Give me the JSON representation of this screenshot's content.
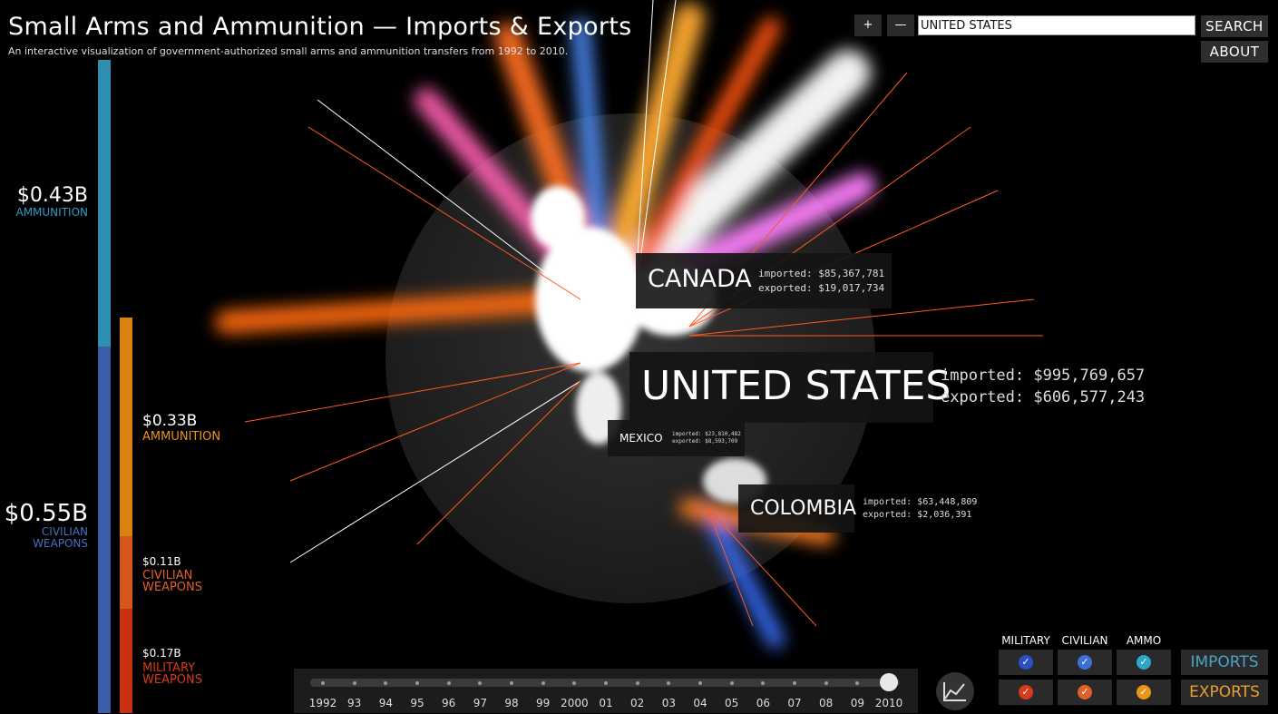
{
  "header": {
    "title": "Small Arms and Ammunition — Imports & Exports",
    "subtitle": "An interactive visualization of government-authorized small arms and ammunition transfers from 1992 to 2010."
  },
  "controls": {
    "zoom_in": "+",
    "zoom_out": "—",
    "search_value": "UNITED STATES",
    "search_label": "SEARCH",
    "about_label": "ABOUT"
  },
  "imports_panel": {
    "total": "$0.55B",
    "total_label_1": "CIVILIAN",
    "total_label_2": "WEAPONS",
    "ammo_value": "$0.43B",
    "ammo_label": "AMMUNITION"
  },
  "exports_panel": {
    "ammo_value": "$0.33B",
    "ammo_label": "AMMUNITION",
    "civilian_value": "$0.11B",
    "civilian_label_1": "CIVILIAN",
    "civilian_label_2": "WEAPONS",
    "military_value": "$0.17B",
    "military_label_1": "MILITARY",
    "military_label_2": "WEAPONS"
  },
  "countries": {
    "selected": {
      "name": "UNITED STATES",
      "imported": "imported: $995,769,657",
      "exported": "exported: $606,577,243"
    },
    "canada": {
      "name": "CANADA",
      "imported": "imported: $85,367,781",
      "exported": "exported: $19,017,734"
    },
    "mexico": {
      "name": "MEXICO",
      "imported": "imported: $23,810,482",
      "exported": "exported: $8,593,709"
    },
    "colombia": {
      "name": "COLOMBIA",
      "imported": "imported: $63,448,809",
      "exported": "exported: $2,036,391"
    }
  },
  "timeline": {
    "years": [
      "1992",
      "93",
      "94",
      "95",
      "96",
      "97",
      "98",
      "99",
      "2000",
      "01",
      "02",
      "03",
      "04",
      "05",
      "06",
      "07",
      "08",
      "09",
      "2010"
    ],
    "selected": "2010"
  },
  "filters": {
    "columns": [
      "MILITARY",
      "CIVILIAN",
      "AMMO"
    ],
    "imports_label": "IMPORTS",
    "exports_label": "EXPORTS",
    "check_glyph": "✓"
  },
  "colors": {
    "imports": "#4aa3c8",
    "exports": "#e8a030",
    "ammo_import": "#2e8fb0",
    "civilian_import": "#3a5fa8",
    "ammo_export": "#d9820f",
    "civilian_export": "#d4581a",
    "military_export": "#c8320f"
  },
  "icons": {
    "chart": "line-chart-icon"
  }
}
